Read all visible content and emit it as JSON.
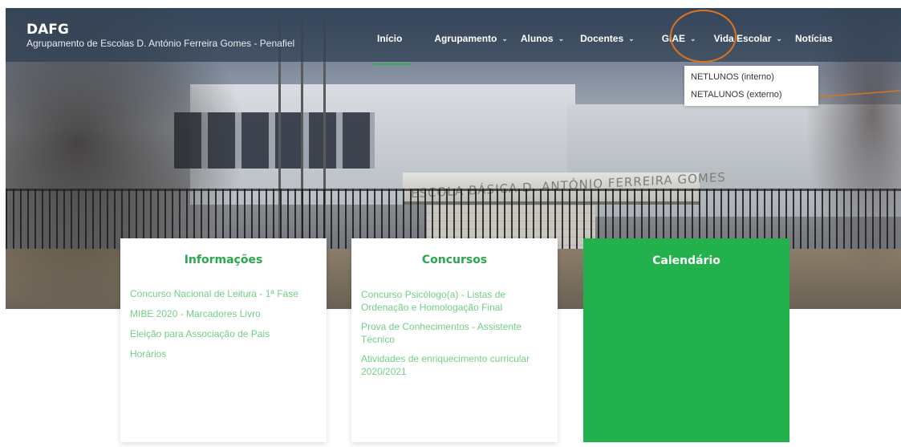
{
  "brand": {
    "title": "DAFG",
    "subtitle": "Agrupamento de Escolas D. António Ferreira Gomes - Penafiel"
  },
  "nav": {
    "items": [
      {
        "label": "Início",
        "dropdown": false,
        "active": true
      },
      {
        "label": "Agrupamento",
        "dropdown": true
      },
      {
        "label": "Alunos",
        "dropdown": true
      },
      {
        "label": "Docentes",
        "dropdown": true
      },
      {
        "label": "GIAE",
        "dropdown": true
      },
      {
        "label": "Vida Escolar",
        "dropdown": true
      },
      {
        "label": "Notícias",
        "dropdown": false
      }
    ],
    "caret": "⌄"
  },
  "giae_dropdown": {
    "items": [
      "NETLUNOS (interno)",
      "NETALUNOS (externo)"
    ]
  },
  "hero": {
    "school_sign": "ESCOLA BÁSICA D. ANTÓNIO FERREIRA GOMES"
  },
  "cards": {
    "informacoes": {
      "title": "Informações",
      "links": [
        "Concurso Nacional de Leitura - 1ª Fase",
        "MIBE 2020 - Marcadores Livro",
        "Eleição para Associação de Pais",
        "Horários"
      ]
    },
    "concursos": {
      "title": "Concursos",
      "links": [
        "Concurso Psicólogo(a) - Listas de Ordenação e Homologação Final",
        "Prova de Conhecimentos - Assistente Técnico",
        "Atividades de enriquecimento curricular 2020/2021"
      ]
    },
    "calendario": {
      "title": "Calendário"
    }
  },
  "colors": {
    "accent_green": "#2aa84a",
    "link_green": "#6fcf86",
    "calendar_green": "#23b14d",
    "annotation_orange": "#d9741f",
    "navbar_bg": "rgba(46,62,82,0.72)"
  }
}
